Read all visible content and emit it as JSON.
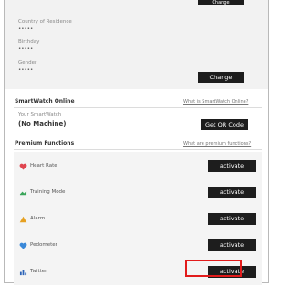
{
  "top": {
    "change_top_label": "Change",
    "fields": [
      {
        "label": "Country of Residence",
        "value": "•••••"
      },
      {
        "label": "Birthday",
        "value": "•••••"
      },
      {
        "label": "Gender",
        "value": "•••••"
      }
    ],
    "change_label": "Change"
  },
  "smartwatch": {
    "title": "SmartWatch Online",
    "link": "What is SmartWatch Online?",
    "sub_label": "Your SmartWatch",
    "machine": "(No Machine)",
    "qr_button": "Get QR Code"
  },
  "premium": {
    "title": "Premium Functions",
    "link": "What are premium functions?",
    "items": [
      {
        "label": "Heart Rate",
        "icon": "heart-icon",
        "button": "activate",
        "color": "#e0454f"
      },
      {
        "label": "Training Mode",
        "icon": "training-icon",
        "button": "activate",
        "color": "#3aa55a"
      },
      {
        "label": "Alarm",
        "icon": "alarm-icon",
        "button": "activate",
        "color": "#e6a020"
      },
      {
        "label": "Pedometer",
        "icon": "pedometer-icon",
        "button": "activate",
        "color": "#3a88d8"
      },
      {
        "label": "Twitter",
        "icon": "twitter-icon",
        "button": "activate",
        "color": "#2c63b8"
      }
    ]
  }
}
